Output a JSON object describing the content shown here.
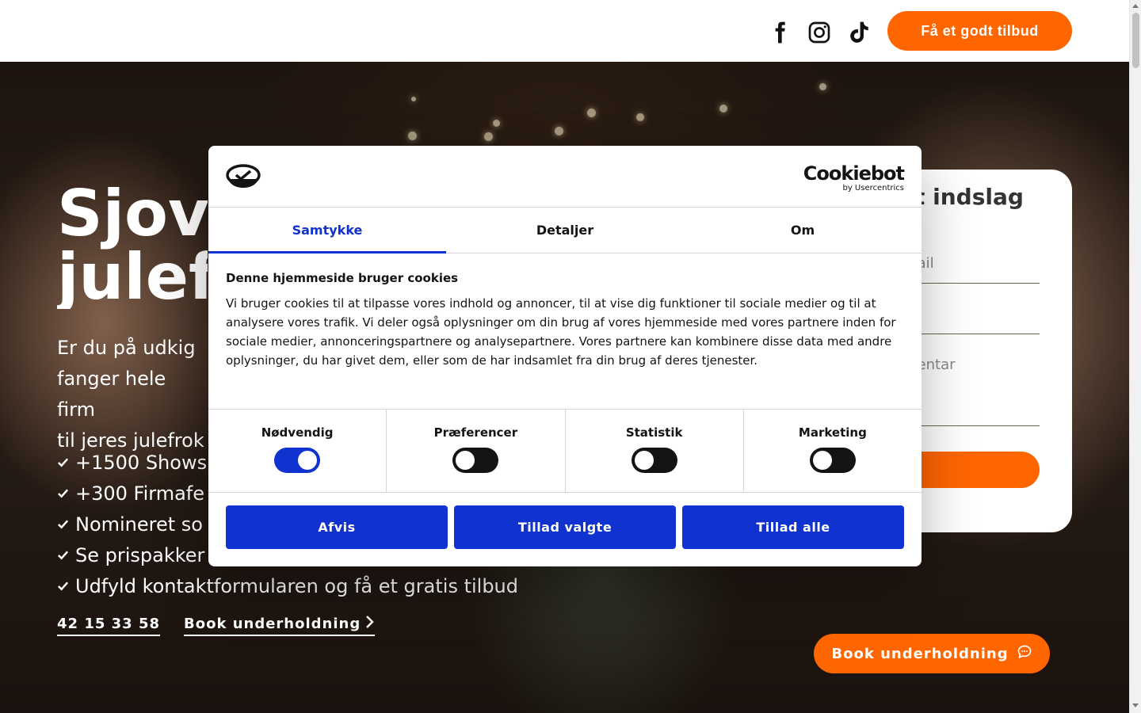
{
  "header": {
    "social": [
      {
        "name": "facebook-icon"
      },
      {
        "name": "instagram-icon"
      },
      {
        "name": "tiktok-icon"
      }
    ],
    "cta_label": "Få et godt tilbud"
  },
  "hero": {
    "title": "Sjov\njulef",
    "subtitle": "Er du på udkig\nfanger hele firm\ntil jeres julefrok",
    "bullets": [
      "+1500 Shows",
      "+300 Firmafe",
      "Nomineret so",
      "Se prispakker",
      "Udfyld kontaktformularen og få et gratis tilbud"
    ],
    "phone": "42 15 33 58",
    "book_link": "Book underholdning"
  },
  "form": {
    "title": "t indslag",
    "email_placeholder": "mail",
    "comment_placeholder": "mentar"
  },
  "floating_cta": "Book underholdning",
  "cookie_dialog": {
    "brand": "Cookiebot",
    "brand_by": "by Usercentrics",
    "tabs": [
      "Samtykke",
      "Detaljer",
      "Om"
    ],
    "active_tab": "Samtykke",
    "heading": "Denne hjemmeside bruger cookies",
    "body": "Vi bruger cookies til at tilpasse vores indhold og annoncer, til at vise dig funktioner til sociale medier og til at analysere vores trafik. Vi deler også oplysninger om din brug af vores hjemmeside med vores partnere inden for sociale medier, annonceringspartnere og analysepartnere. Vores partnere kan kombinere disse data med andre oplysninger, du har givet dem, eller som de har indsamlet fra din brug af deres tjenester.",
    "toggles": [
      {
        "label": "Nødvendig",
        "on": true
      },
      {
        "label": "Præferencer",
        "on": false
      },
      {
        "label": "Statistik",
        "on": false
      },
      {
        "label": "Marketing",
        "on": false
      }
    ],
    "buttons": [
      "Afvis",
      "Tillad valgte",
      "Tillad alle"
    ]
  },
  "colors": {
    "accent_orange": "#ff6600",
    "cookiebot_blue": "#1032cf"
  }
}
